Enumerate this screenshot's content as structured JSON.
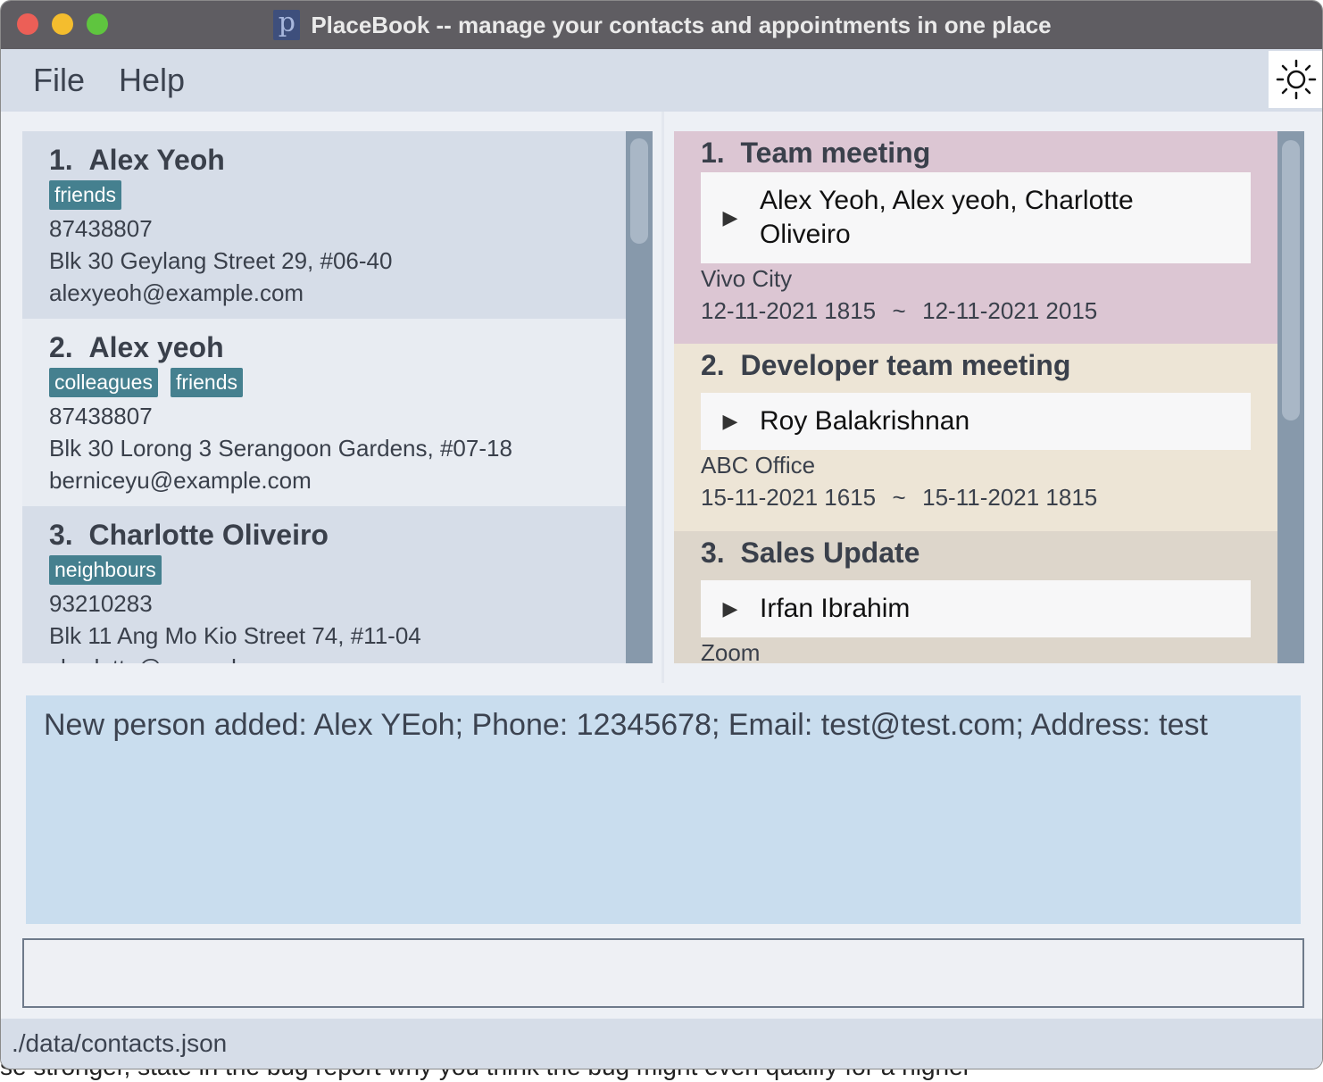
{
  "window": {
    "title": "PlaceBook -- manage your contacts and appointments in one place",
    "app_icon_letter": "p"
  },
  "menu": {
    "file": "File",
    "help": "Help",
    "theme_icon": "sun-icon"
  },
  "persons": [
    {
      "index": "1.",
      "name": "Alex Yeoh",
      "tags": [
        "friends"
      ],
      "phone": "87438807",
      "address": "Blk 30 Geylang Street 29, #06-40",
      "email": "alexyeoh@example.com"
    },
    {
      "index": "2.",
      "name": "Alex yeoh",
      "tags": [
        "colleagues",
        "friends"
      ],
      "phone": "87438807",
      "address": "Blk 30 Lorong 3 Serangoon Gardens, #07-18",
      "email": "berniceyu@example.com"
    },
    {
      "index": "3.",
      "name": "Charlotte Oliveiro",
      "tags": [
        "neighbours"
      ],
      "phone": "93210283",
      "address": "Blk 11 Ang Mo Kio Street 74, #11-04",
      "email": "charlotte@example.com"
    }
  ],
  "appointments": [
    {
      "index": "1.",
      "description": "Team meeting",
      "persons": "Alex Yeoh, Alex yeoh, Charlotte Oliveiro",
      "location": "Vivo City",
      "start": "12-11-2021 1815",
      "end": "12-11-2021 2015",
      "color": "#dcc6d3"
    },
    {
      "index": "2.",
      "description": "Developer team meeting",
      "persons": "Roy Balakrishnan",
      "location": "ABC Office",
      "start": "15-11-2021 1615",
      "end": "15-11-2021 1815",
      "color": "#ede5d6"
    },
    {
      "index": "3.",
      "description": "Sales Update",
      "persons": "Irfan Ibrahim",
      "location": "Zoom",
      "color": "#ddd6cb"
    }
  ],
  "time_separator": "~",
  "result": {
    "text": "New person added: Alex YEoh; Phone: 12345678; Email: test@test.com; Address: test"
  },
  "command": {
    "value": ""
  },
  "status": {
    "file_path": "./data/contacts.json"
  },
  "background_text": "se stronger, state in the bug report why you think the bug might even qualify for a higher"
}
